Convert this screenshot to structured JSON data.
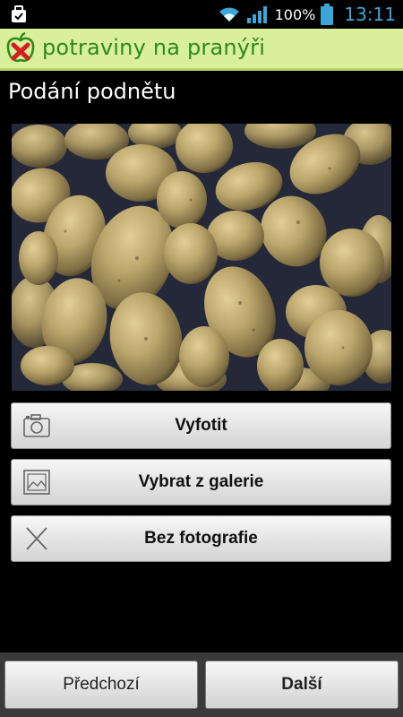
{
  "statusbar": {
    "battery_percent": "100%",
    "time": "13:11",
    "icons": [
      "briefcase-icon",
      "wifi-icon",
      "signal-icon",
      "battery-icon"
    ]
  },
  "brand": {
    "name": "potraviny na pranýři",
    "logo_icon": "apple-x-logo",
    "background_color": "#d9ef9c",
    "text_color": "#2e8a1a"
  },
  "page": {
    "title": "Podání podnětu"
  },
  "photo": {
    "subject": "potatoes"
  },
  "actions": {
    "take_photo": "Vyfotit",
    "choose_gallery": "Vybrat z galerie",
    "no_photo": "Bez fotografie"
  },
  "navigation": {
    "previous": "Předchozí",
    "next": "Další"
  },
  "colors": {
    "clock_accent": "#3aa7d8",
    "button_text": "#111111"
  }
}
